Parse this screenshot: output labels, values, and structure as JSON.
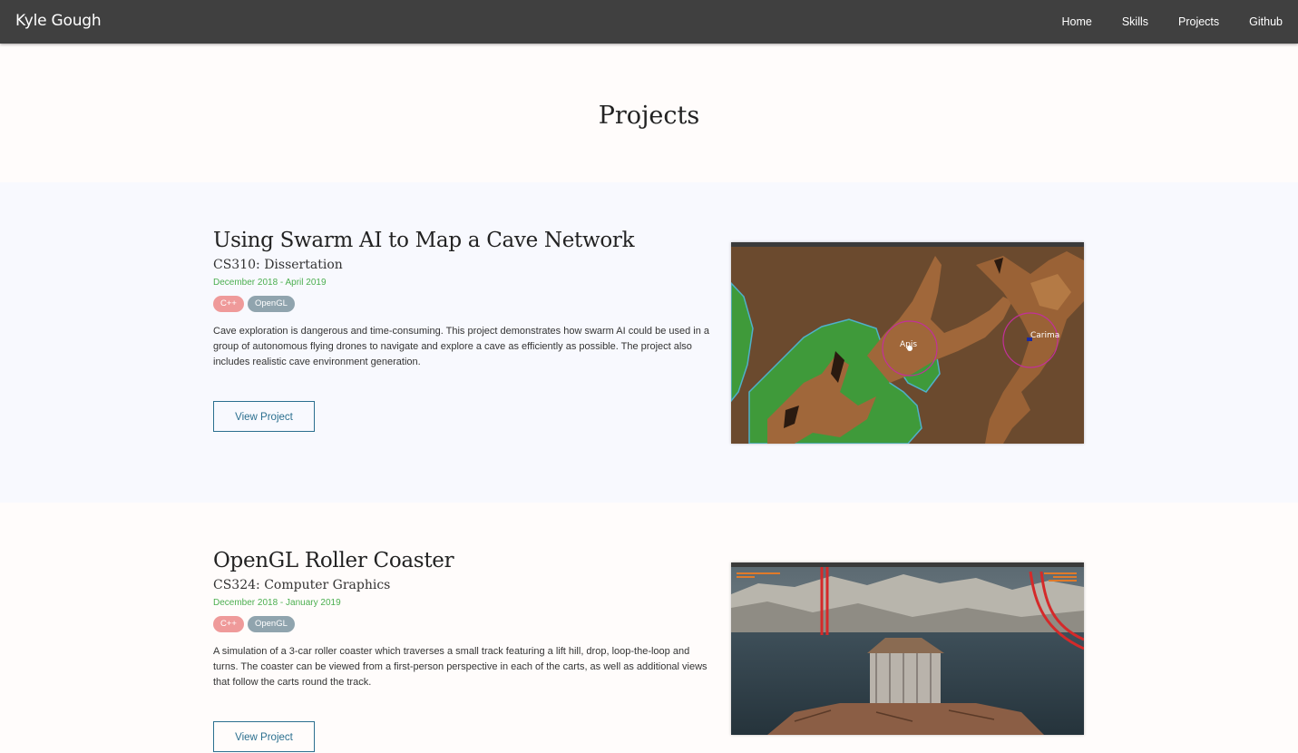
{
  "nav": {
    "brand": "Kyle Gough",
    "links": [
      "Home",
      "Skills",
      "Projects",
      "Github"
    ]
  },
  "page_title": "Projects",
  "projects": [
    {
      "title": "Using Swarm AI to Map a Cave Network",
      "course": "CS310: Dissertation",
      "date": "December 2018 - April 2019",
      "tags": [
        {
          "label": "C++",
          "color": "#ef9a9a"
        },
        {
          "label": "OpenGL",
          "color": "#90a4ae"
        }
      ],
      "description": "Cave exploration is dangerous and time-consuming. This project demonstrates how swarm AI could be used in a group of autonomous flying drones to navigate and explore a cave as efficiently as possible. The project also includes realistic cave environment generation.",
      "button": "View Project",
      "screenshot_labels": [
        "Apis",
        "Carima"
      ]
    },
    {
      "title": "OpenGL Roller Coaster",
      "course": "CS324: Computer Graphics",
      "date": "December 2018 - January 2019",
      "tags": [
        {
          "label": "C++",
          "color": "#ef9a9a"
        },
        {
          "label": "OpenGL",
          "color": "#90a4ae"
        }
      ],
      "description": "A simulation of a 3-car roller coaster which traverses a small track featuring a lift hill, drop, loop-the-loop and turns. The coaster can be viewed from a first-person perspective in each of the carts, as well as additional views that follow the carts round the track.",
      "button": "View Project"
    }
  ],
  "colors": {
    "navbar": "#404040",
    "accent_green": "#4caf50",
    "button": "#2b6f8f",
    "section_alt": "#f8f9fe"
  }
}
